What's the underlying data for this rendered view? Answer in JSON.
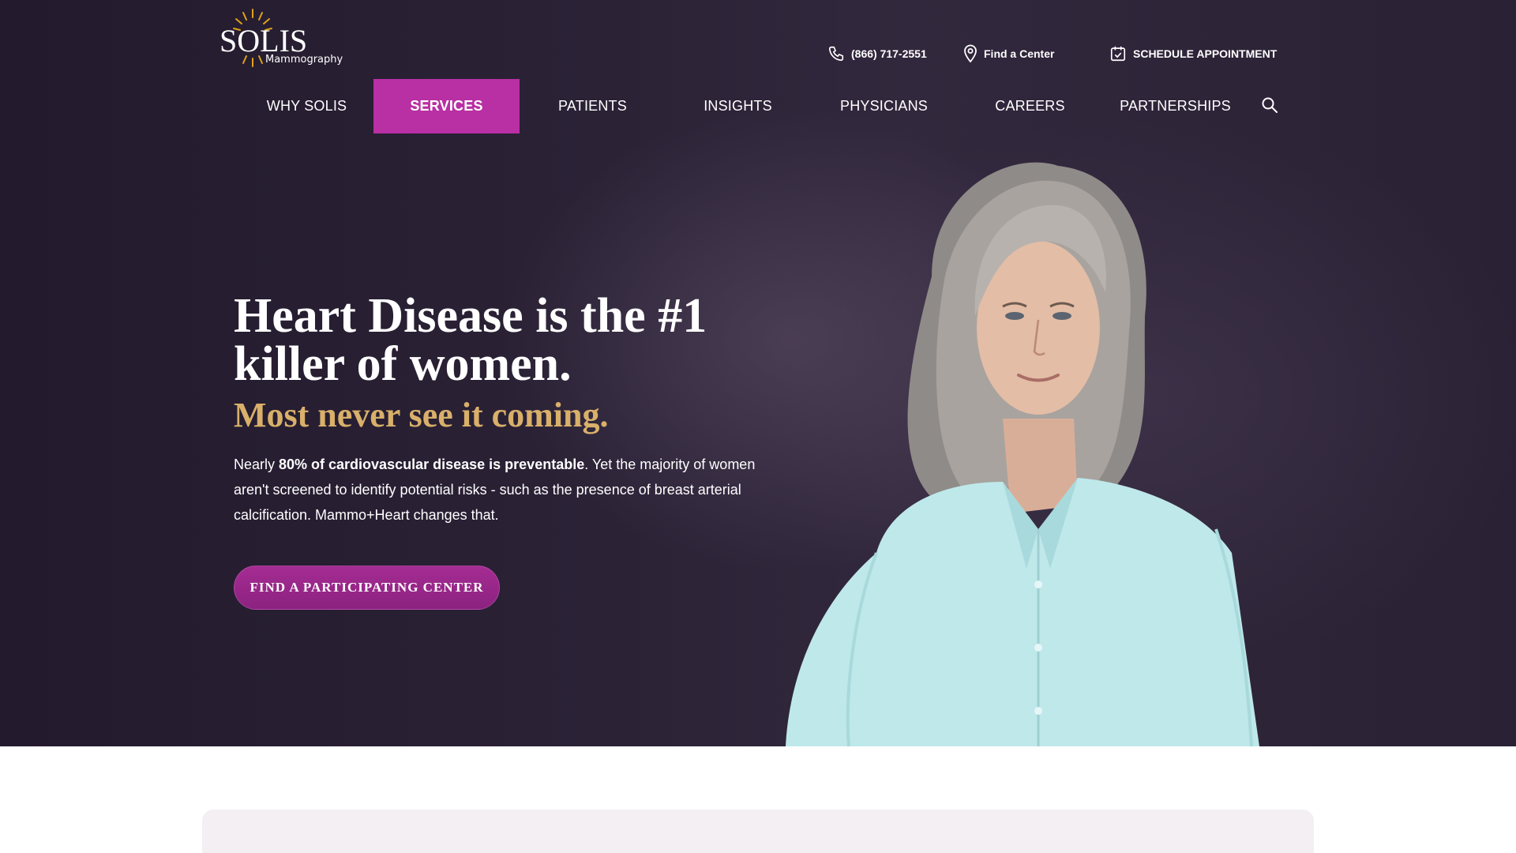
{
  "brand": {
    "name": "SOLIS",
    "sub": "Mammography",
    "accent": "#b92fa4",
    "gold": "#d9b06a",
    "sun_color": "#e0a21b"
  },
  "utility": {
    "phone": "(866) 717-2551",
    "find_center": "Find a Center",
    "schedule": "SCHEDULE APPOINTMENT"
  },
  "nav": {
    "items": [
      {
        "label": "WHY SOLIS"
      },
      {
        "label": "SERVICES",
        "active": true
      },
      {
        "label": "PATIENTS"
      },
      {
        "label": "INSIGHTS"
      },
      {
        "label": "PHYSICIANS"
      },
      {
        "label": "CAREERS"
      },
      {
        "label": "PARTNERSHIPS"
      }
    ],
    "search_icon": "search-icon"
  },
  "hero": {
    "headline": "Heart Disease is the #1 killer of women.",
    "subhead": "Most never see it coming.",
    "body_pre": "Nearly ",
    "body_bold": "80% of cardiovascular disease is preventable",
    "body_post": ". Yet the majority of women aren't screened to identify potential risks - such as the presence of breast arterial calcification. Mammo+Heart changes that.",
    "cta": "FIND A PARTICIPATING CENTER"
  }
}
